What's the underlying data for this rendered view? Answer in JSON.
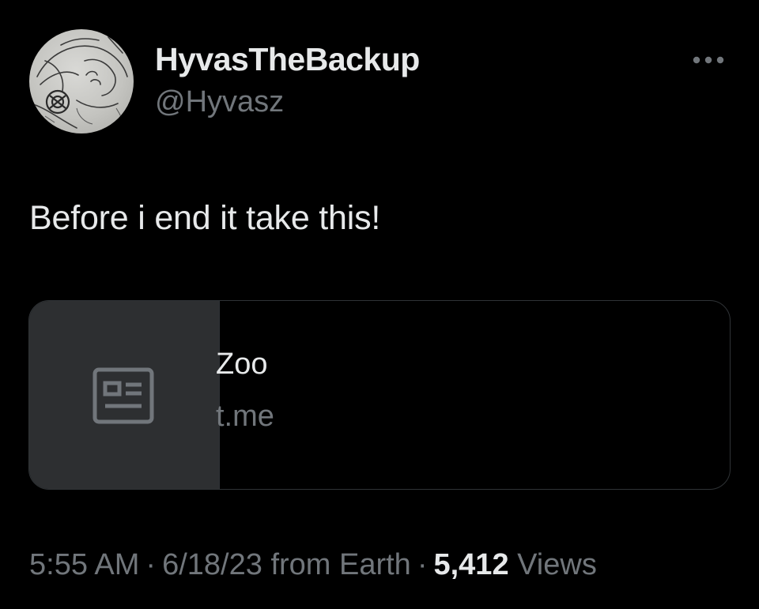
{
  "author": {
    "display_name": "HyvasTheBackup",
    "handle": "@Hyvasz",
    "avatar_icon": "sketch-avatar"
  },
  "more_icon": "more-horizontal-icon",
  "tweet": {
    "text": "Before i end it take this!"
  },
  "link_card": {
    "thumbnail_icon": "news-article-icon",
    "title": "Zoo",
    "domain": "t.me"
  },
  "meta": {
    "time": "5:55 AM",
    "date": "6/18/23",
    "source": "from Earth",
    "separator": "·",
    "views_count": "5,412",
    "views_label": "Views"
  },
  "colors": {
    "background": "#000000",
    "primary_text": "#e7e9ea",
    "secondary_text": "#71767b",
    "card_border": "#2f3336",
    "thumb_bg": "#2d2f31"
  }
}
